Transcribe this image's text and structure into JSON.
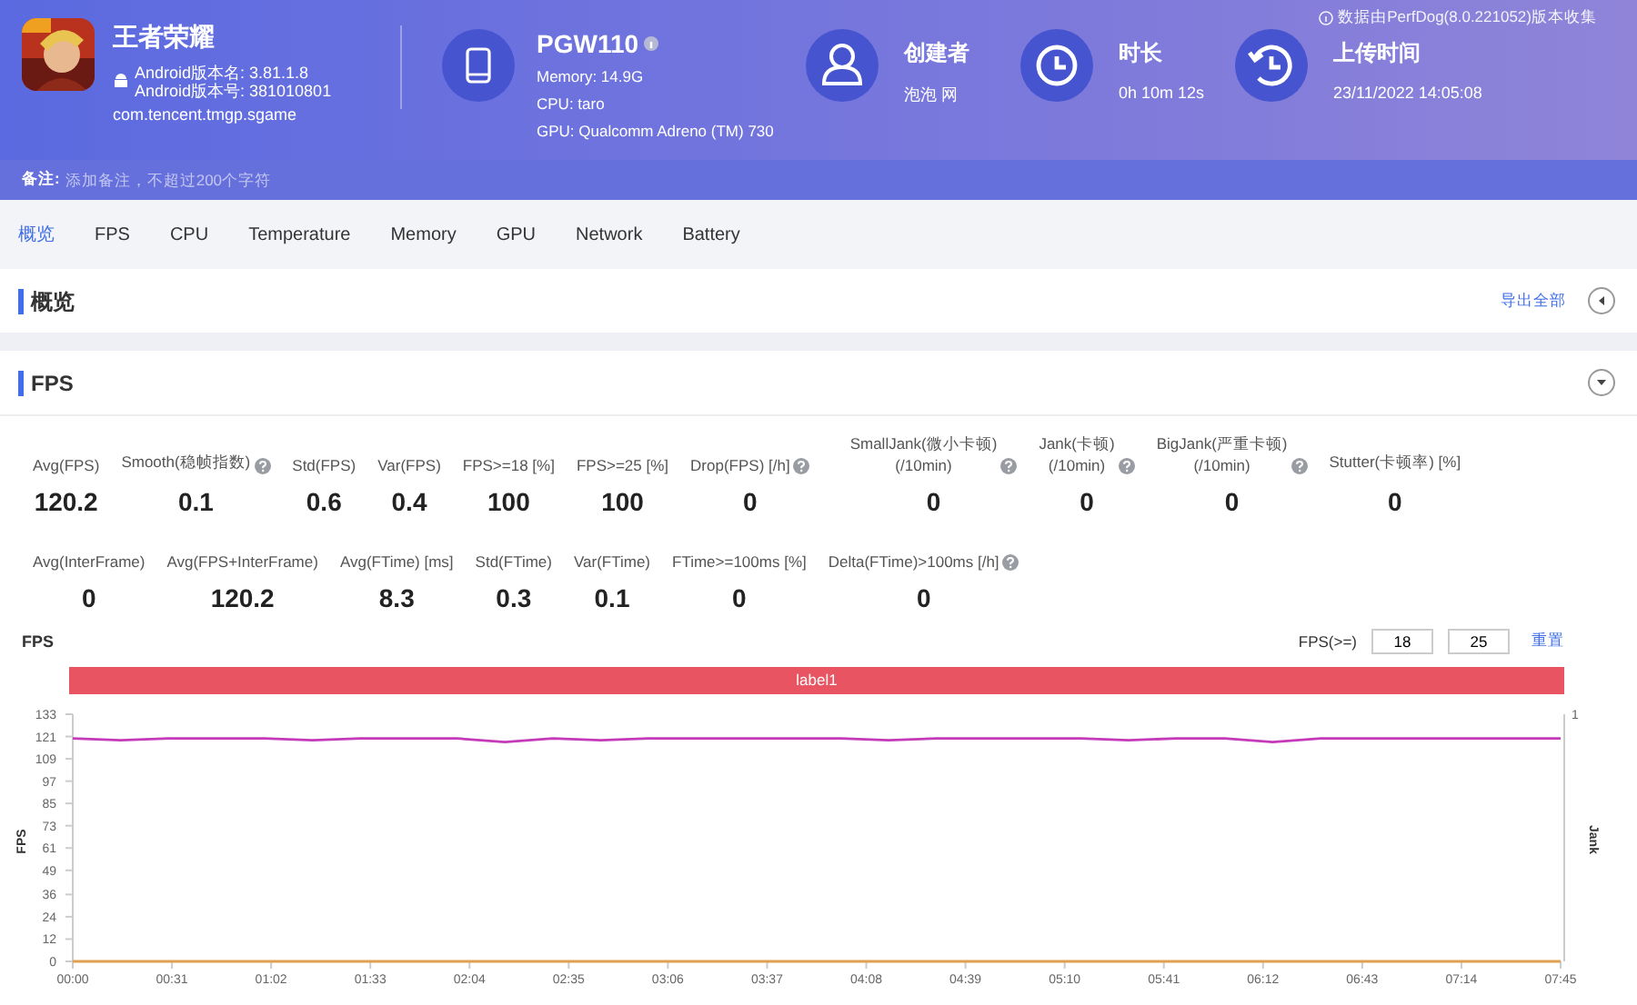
{
  "app": {
    "name": "王者荣耀",
    "version_name": "Android版本名: 3.81.1.8",
    "version_code": "Android版本号: 381010801",
    "package": "com.tencent.tmgp.sgame"
  },
  "device": {
    "model": "PGW110",
    "memory": "Memory: 14.9G",
    "cpu": "CPU: taro",
    "gpu": "GPU: Qualcomm Adreno (TM) 730"
  },
  "info_items": [
    {
      "kind": "user",
      "label": "创建者",
      "value": "泡泡 网"
    },
    {
      "kind": "clock",
      "label": "时长",
      "value": "0h 10m 12s"
    },
    {
      "kind": "history",
      "label": "上传时间",
      "value": "23/11/2022 14:05:08"
    }
  ],
  "collector_note": "数据由PerfDog(8.0.221052)版本收集",
  "note": {
    "label": "备注:",
    "placeholder": "添加备注，不超过200个字符"
  },
  "tabs": [
    {
      "label": "概览",
      "selected": true
    },
    {
      "label": "FPS",
      "selected": false
    },
    {
      "label": "CPU",
      "selected": false
    },
    {
      "label": "Temperature",
      "selected": false
    },
    {
      "label": "Memory",
      "selected": false
    },
    {
      "label": "GPU",
      "selected": false
    },
    {
      "label": "Network",
      "selected": false
    },
    {
      "label": "Battery",
      "selected": false
    }
  ],
  "overview": {
    "title": "概览",
    "export_link": "导出全部",
    "expanded": false
  },
  "fps_section": {
    "title": "FPS",
    "expanded": true,
    "metric_rows": [
      [
        {
          "label": "Avg(FPS)",
          "value": "120.2",
          "help": false
        },
        {
          "label": "Smooth(稳帧指数)",
          "value": "0.1",
          "help": true
        },
        {
          "label": "Std(FPS)",
          "value": "0.6",
          "help": false
        },
        {
          "label": "Var(FPS)",
          "value": "0.4",
          "help": false
        },
        {
          "label": "FPS>=18 [%]",
          "value": "100",
          "help": false
        },
        {
          "label": "FPS>=25 [%]",
          "value": "100",
          "help": false
        },
        {
          "label": "Drop(FPS) [/h]",
          "value": "0",
          "help": true
        },
        {
          "label": "SmallJank(微小卡顿)\n(/10min)",
          "value": "0",
          "help": true
        },
        {
          "label": "Jank(卡顿)\n(/10min)",
          "value": "0",
          "help": true
        },
        {
          "label": "BigJank(严重卡顿)\n(/10min)",
          "value": "0",
          "help": true
        },
        {
          "label": "Stutter(卡顿率) [%]",
          "value": "0",
          "help": false
        }
      ],
      [
        {
          "label": "Avg(InterFrame)",
          "value": "0",
          "help": false
        },
        {
          "label": "Avg(FPS+InterFrame)",
          "value": "120.2",
          "help": false
        },
        {
          "label": "Avg(FTime) [ms]",
          "value": "8.3",
          "help": false
        },
        {
          "label": "Std(FTime)",
          "value": "0.3",
          "help": false
        },
        {
          "label": "Var(FTime)",
          "value": "0.1",
          "help": false
        },
        {
          "label": "FTime>=100ms [%]",
          "value": "0",
          "help": false
        },
        {
          "label": "Delta(FTime)>100ms [/h]",
          "value": "0",
          "help": true
        }
      ]
    ],
    "chart": {
      "title": "FPS",
      "threshold_label": "FPS(>=)",
      "thresholds": [
        "18",
        "25"
      ],
      "reset_link": "重置",
      "label_bar": "label1",
      "right_axis_tick": "1",
      "right_axis_label": "Jank",
      "chart_data": {
        "type": "line",
        "ylabel": "FPS",
        "x": [
          0,
          15,
          30,
          45,
          60,
          75,
          90,
          105,
          120,
          135,
          150,
          165,
          180,
          195,
          210,
          225,
          240,
          255,
          270,
          285,
          300,
          315,
          330,
          345,
          360,
          375,
          390,
          405,
          420,
          435,
          450,
          465
        ],
        "series": [
          {
            "color": "#c43ab8",
            "values": [
              120,
              119,
              120,
              120,
              120,
              119,
              120,
              120,
              120,
              118,
              120,
              119,
              120,
              120,
              120,
              120,
              120,
              119,
              120,
              120,
              120,
              120,
              119,
              120,
              120,
              118,
              120,
              120,
              120,
              120,
              120,
              120
            ]
          },
          {
            "color": "#e0a050",
            "values": [
              0,
              0,
              0,
              0,
              0,
              0,
              0,
              0,
              0,
              0,
              0,
              0,
              0,
              0,
              0,
              0,
              0,
              0,
              0,
              0,
              0,
              0,
              0,
              0,
              0,
              0,
              0,
              0,
              0,
              0,
              0,
              0
            ]
          }
        ],
        "xlim": [
          0,
          465
        ],
        "ylim": [
          0,
          133
        ],
        "xticks": [
          {
            "value": 0,
            "label": "00:00"
          },
          {
            "value": 31,
            "label": "00:31"
          },
          {
            "value": 62,
            "label": "01:02"
          },
          {
            "value": 93,
            "label": "01:33"
          },
          {
            "value": 124,
            "label": "02:04"
          },
          {
            "value": 155,
            "label": "02:35"
          },
          {
            "value": 186,
            "label": "03:06"
          },
          {
            "value": 217,
            "label": "03:37"
          },
          {
            "value": 248,
            "label": "04:08"
          },
          {
            "value": 279,
            "label": "04:39"
          },
          {
            "value": 310,
            "label": "05:10"
          },
          {
            "value": 341,
            "label": "05:41"
          },
          {
            "value": 372,
            "label": "06:12"
          },
          {
            "value": 403,
            "label": "06:43"
          },
          {
            "value": 434,
            "label": "07:14"
          },
          {
            "value": 465,
            "label": "07:45"
          }
        ],
        "yticks": [
          0,
          12,
          24,
          36,
          49,
          61,
          73,
          85,
          97,
          109,
          121,
          133
        ]
      }
    }
  }
}
